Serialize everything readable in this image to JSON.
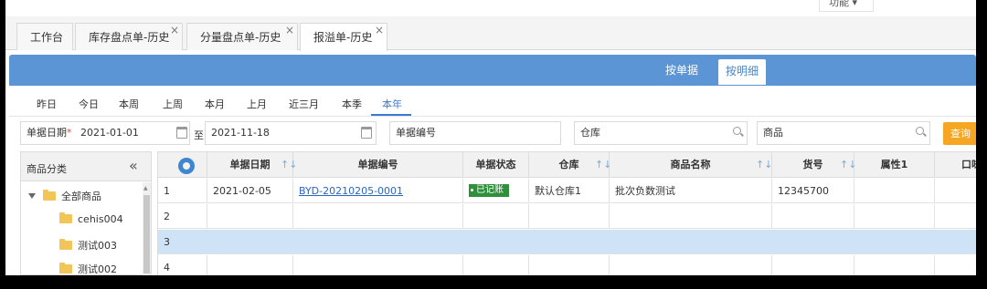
{
  "function_menu": "功能 ▾",
  "tabs": [
    {
      "label": "工作台",
      "closable": false,
      "active": false
    },
    {
      "label": "库存盘点单-历史",
      "closable": true,
      "active": false
    },
    {
      "label": "分量盘点单-历史",
      "closable": true,
      "active": false
    },
    {
      "label": "报溢单-历史",
      "closable": true,
      "active": true
    }
  ],
  "view_toggle": {
    "by_document": "按单据",
    "by_detail": "按明细"
  },
  "periods": [
    "昨日",
    "今日",
    "本周",
    "上周",
    "本月",
    "上月",
    "近三月",
    "本季",
    "本年"
  ],
  "active_period": "本年",
  "filters": {
    "date_label": "单据日期",
    "required_mark": "*",
    "date_from": "2021-01-01",
    "to_label": "至",
    "date_to": "2021-11-18",
    "doc_no_placeholder": "单据编号",
    "warehouse_placeholder": "仓库",
    "product_placeholder": "商品",
    "query_button": "查询"
  },
  "category_panel": {
    "title": "商品分类",
    "collapse_icon": "«",
    "root": "全部商品",
    "items": [
      "cehis004",
      "测试003",
      "测试002"
    ]
  },
  "grid": {
    "columns": [
      "单据日期",
      "单据编号",
      "单据状态",
      "仓库",
      "商品名称",
      "货号",
      "属性1",
      "口味"
    ],
    "rows": [
      {
        "num": "1",
        "date": "2021-02-05",
        "doc_no": "BYD-20210205-0001",
        "status": "已记账",
        "warehouse": "默认仓库1",
        "product": "批次负数测试",
        "sku": "12345700",
        "attr1": ""
      },
      {
        "num": "2",
        "date": "",
        "doc_no": "",
        "status": "",
        "warehouse": "",
        "product": "",
        "sku": "",
        "attr1": ""
      },
      {
        "num": "3",
        "date": "",
        "doc_no": "",
        "status": "",
        "warehouse": "",
        "product": "",
        "sku": "",
        "attr1": ""
      },
      {
        "num": "4",
        "date": "",
        "doc_no": "",
        "status": "",
        "warehouse": "",
        "product": "",
        "sku": "",
        "attr1": ""
      }
    ],
    "selected_row": 3
  },
  "colors": {
    "header_blue": "#5b95d6",
    "active_text": "#3b7ad0",
    "query_orange": "#f5a623",
    "status_green": "#2f8f3a",
    "selected_row": "#cfe3f7"
  },
  "icons": [
    "calendar-icon",
    "search-icon",
    "gear-icon",
    "folder-icon",
    "sort-icon",
    "close-icon",
    "expand-triangle-icon"
  ]
}
